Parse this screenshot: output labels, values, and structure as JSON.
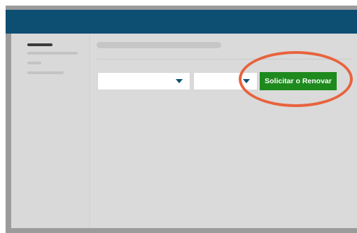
{
  "cta": {
    "label": "Solicitar o Renovar"
  },
  "colors": {
    "header": "#0d4f73",
    "cta_background": "#1e8a1e",
    "highlight_ring": "#e8633d",
    "caret": "#0d4f73"
  },
  "icons": {
    "dropdown": "chevron-down-icon"
  }
}
